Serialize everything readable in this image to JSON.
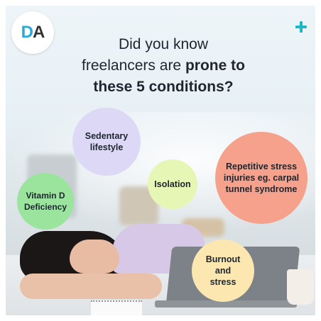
{
  "logo": {
    "letters": "DA"
  },
  "headline": {
    "line1": "Did you know",
    "line2_plain": "freelancers are ",
    "line2_bold": "prone to",
    "line3_bold": "these 5 conditions?"
  },
  "conditions": {
    "sedentary": "Sedentary lifestyle",
    "isolation": "Isolation",
    "repetitive": "Repetitive stress injuries eg. carpal tunnel syndrome",
    "vitamin": "Vitamin D Deficiency",
    "burnout": "Burnout and stress"
  },
  "colors": {
    "brand_blue": "#2aa9d9",
    "plus_teal": "#1fb6c8",
    "sedentary": "#dcd8f5",
    "isolation": "#e6f6b4",
    "repetitive": "#f6a18c",
    "vitamin": "#9be49d",
    "burnout": "#fde7b0"
  },
  "icons": [
    "plus-icon"
  ]
}
